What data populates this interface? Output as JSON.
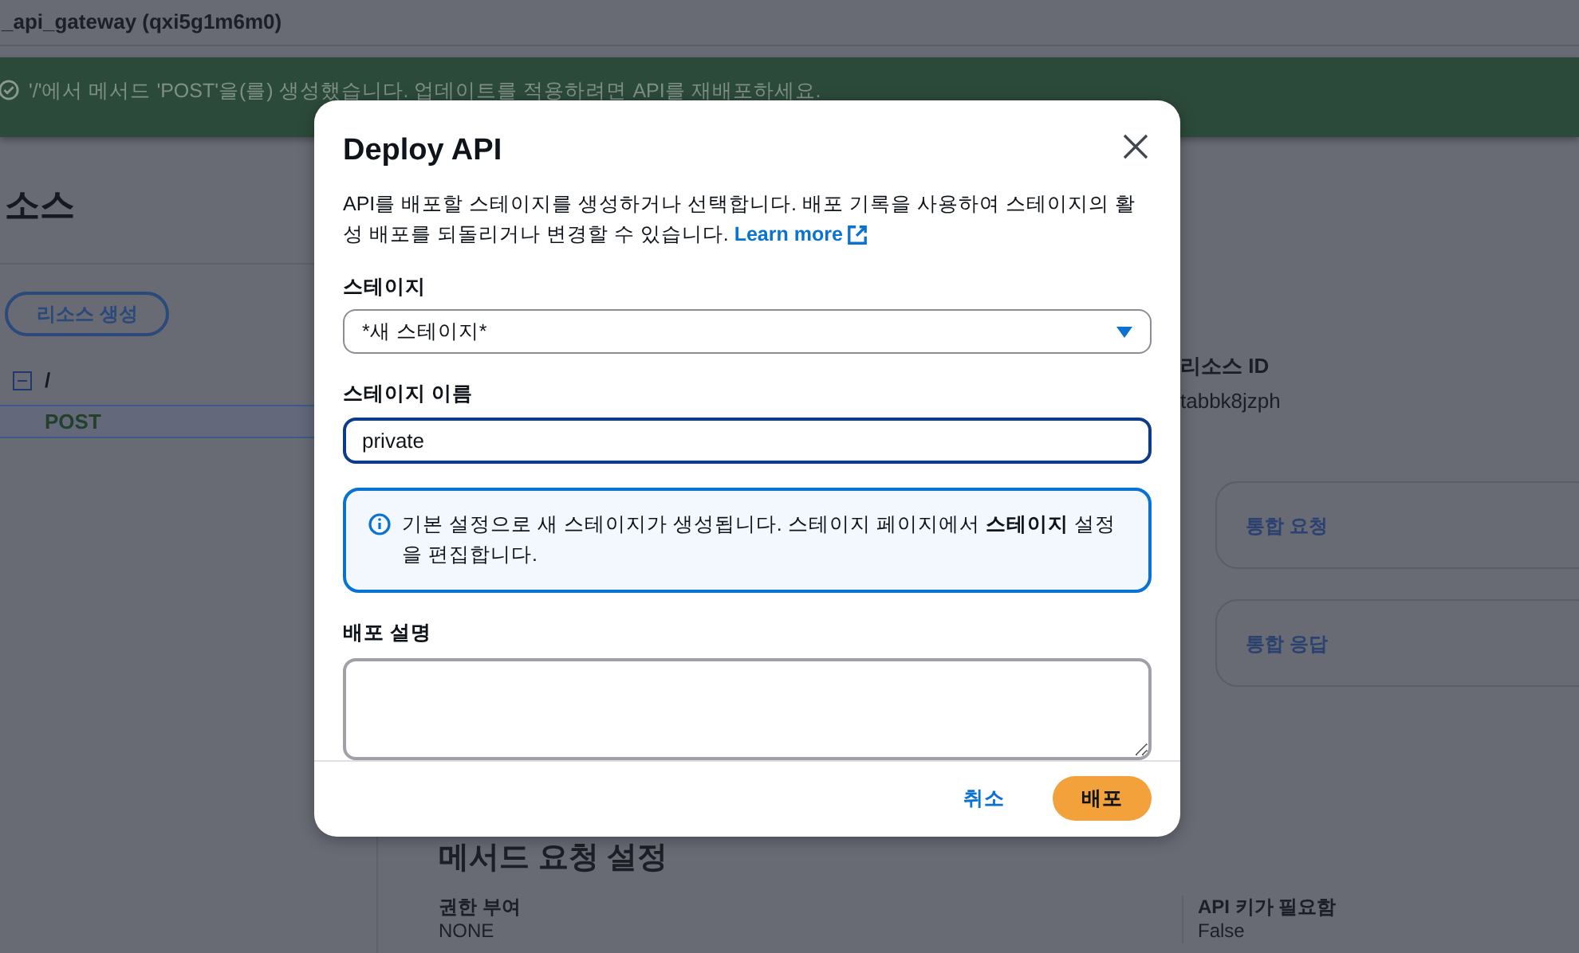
{
  "header": {
    "title": "_api_gateway (qxi5g1m6m0)"
  },
  "flash": {
    "message": "'/'에서 메서드 'POST'을(를) 생성했습니다. 업데이트를 적용하려면 API를 재배포하세요."
  },
  "resources": {
    "heading": "소스",
    "create_button": "리소스 생성",
    "tree": [
      {
        "label": "/",
        "expanded": true,
        "selected": false,
        "children": [
          {
            "label": "POST",
            "selected": true
          }
        ]
      }
    ]
  },
  "details": {
    "resource_id_label": "리소스 ID",
    "resource_id_value": "tabbk8jzph",
    "cards": [
      "통합 요청",
      "통합 응답"
    ]
  },
  "method_request": {
    "heading": "메서드 요청 설정",
    "fields": [
      {
        "label": "권한 부여",
        "value": "NONE"
      },
      {
        "label": "API 키가 필요함",
        "value": "False"
      }
    ]
  },
  "modal": {
    "title": "Deploy API",
    "description": "API를 배포할 스테이지를 생성하거나 선택합니다. 배포 기록을 사용하여 스테이지의 활성 배포를 되돌리거나 변경할 수 있습니다.",
    "link": "Learn more",
    "stage": {
      "label": "스테이지",
      "value": "*새 스테이지*"
    },
    "stage_name": {
      "label": "스테이지 이름",
      "value": "private"
    },
    "info": "기본 설정으로 새 스테이지가 생성됩니다. 스테이지 페이지에서 **스테이지** 설정을 편집합니다.",
    "deploy_description": {
      "label": "배포 설명"
    },
    "cancel_button": "취소",
    "deploy_button": "배포"
  }
}
